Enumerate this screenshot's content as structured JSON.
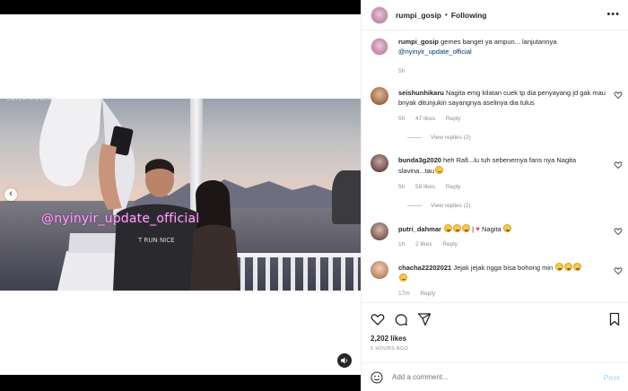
{
  "media": {
    "watermark_label": "ENTERTAINMENT",
    "overlay_handle": "@nyinyir_update_official",
    "jersey_text": "T RUN NICE"
  },
  "header": {
    "username": "rumpi_gosip",
    "separator": "•",
    "follow_label": "Following",
    "more_label": "•••"
  },
  "caption": {
    "username": "rumpi_gosip",
    "text": "gemes banget ya ampun... lanjutannya",
    "mention": "@nyinyir_update_official",
    "time": "5h"
  },
  "comments": [
    {
      "username": "seishunhikaru",
      "text": "Nagita emg kilatan cuek tp dia penyayang jd gak mau bnyak ditunjukin sayangnya aselinya dia tulus",
      "time": "5h",
      "likes": "47 likes",
      "reply": "Reply",
      "view_replies": "View replies (2)"
    },
    {
      "username": "bunda3g2020",
      "text": "heh Rafi...lu tuh sebenernya fans nya Nagita slavina...tau",
      "time": "5h",
      "likes": "59 likes",
      "reply": "Reply",
      "view_replies": "View replies (2)"
    },
    {
      "username": "putri_dahmar",
      "text_after_emoji": "Nagita",
      "separator": "|",
      "time": "1h",
      "likes": "2 likes",
      "reply": "Reply"
    },
    {
      "username": "chacha22202021",
      "text": "Jejak jejak ngga bisa bohong min",
      "time": "17m",
      "reply": "Reply"
    }
  ],
  "actions": {
    "likes": "2,202 likes",
    "posted": "5 HOURS AGO"
  },
  "add_comment": {
    "placeholder": "Add a comment...",
    "post_label": "Post"
  },
  "colors": {
    "link": "#00376b",
    "muted": "#8e8e8e",
    "post_disabled": "#b2dffc",
    "overlay_text": "#f6a6f0"
  }
}
